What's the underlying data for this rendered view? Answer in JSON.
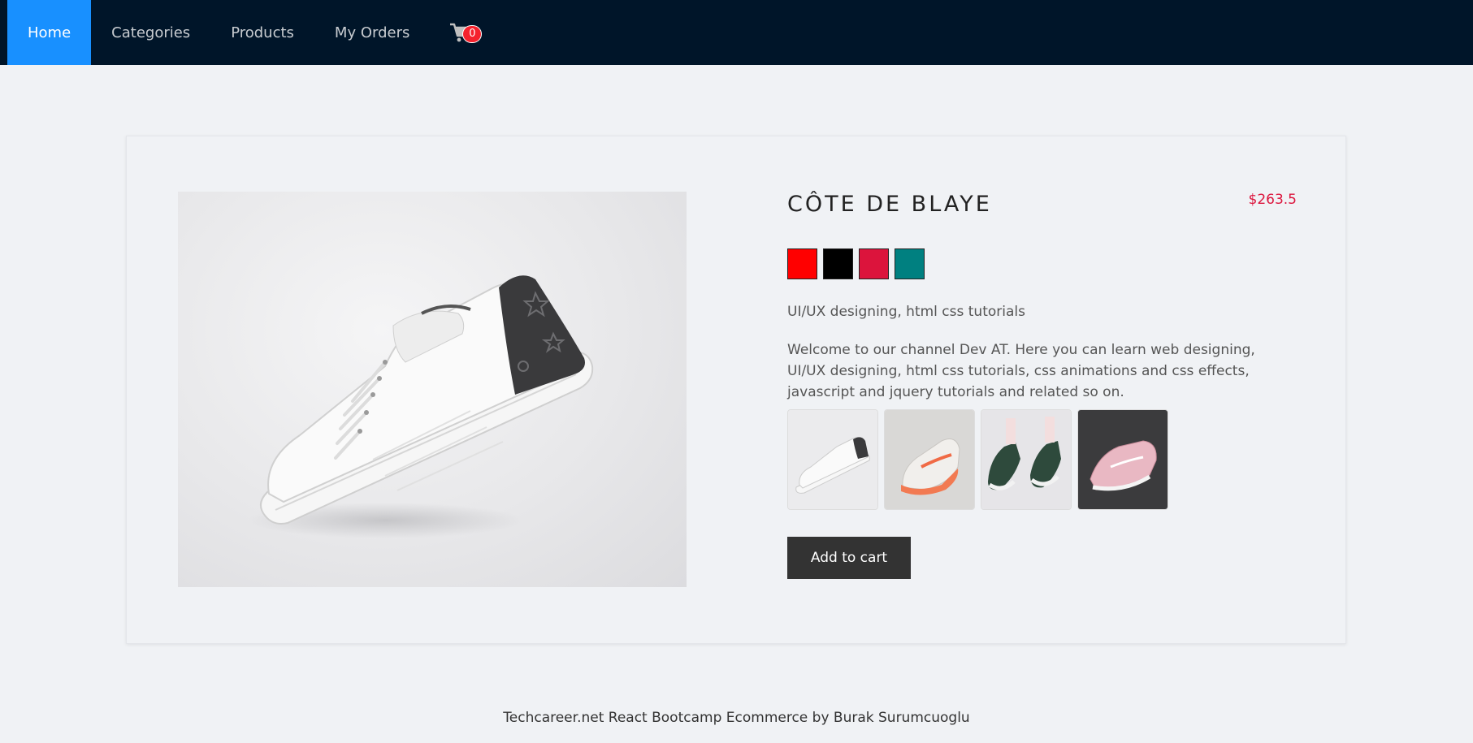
{
  "nav": {
    "items": [
      {
        "label": "Home",
        "active": true
      },
      {
        "label": "Categories",
        "active": false
      },
      {
        "label": "Products",
        "active": false
      },
      {
        "label": "My Orders",
        "active": false
      }
    ],
    "cart_icon": "shopping-cart-icon",
    "cart_count": "0"
  },
  "product": {
    "title": "CÔTE DE BLAYE",
    "price": "$263.5",
    "colors": [
      "#ff0000",
      "#000000",
      "#dc143c",
      "#008080"
    ],
    "subtitle": "UI/UX designing, html css tutorials",
    "description": "Welcome to our channel Dev AT. Here you can learn web designing, UI/UX designing, html css tutorials, css animations and css effects, javascript and jquery tutorials and related so on.",
    "thumbnails": [
      "white-sneaker-thumbnail",
      "orange-sneaker-thumbnail",
      "green-converse-thumbnail",
      "pink-sneaker-thumbnail"
    ],
    "add_to_cart_label": "Add to cart"
  },
  "footer": {
    "text": "Techcareer.net React Bootcamp Ecommerce by Burak Surumcuoglu"
  },
  "colors": {
    "nav_bg": "#001529",
    "nav_active": "#1890ff",
    "price": "#dc143c",
    "button_bg": "#333333"
  }
}
